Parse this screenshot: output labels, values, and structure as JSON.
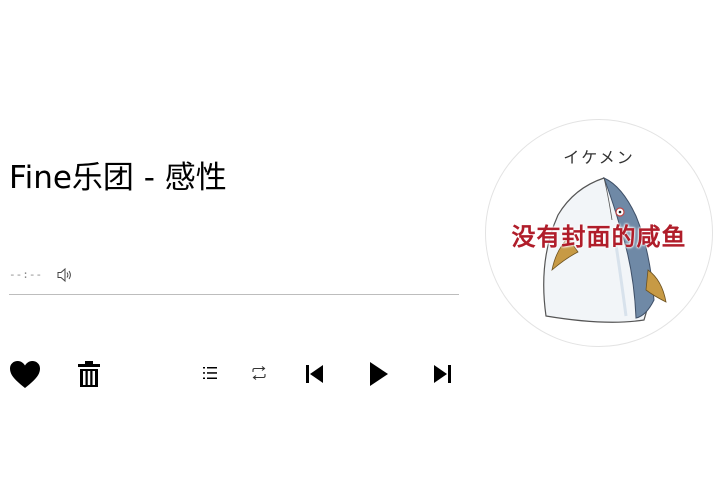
{
  "track": {
    "title": "Fine乐团 - 感性",
    "time": "--:--",
    "progress": 0
  },
  "controls": {
    "like_icon": "heart-icon",
    "delete_icon": "trash-icon",
    "playlist_icon": "list-icon",
    "repeat_icon": "repeat-icon",
    "prev_icon": "skip-previous-icon",
    "play_icon": "play-icon",
    "next_icon": "skip-next-icon",
    "volume_icon": "volume-icon"
  },
  "cover": {
    "caption": "没有封面的咸鱼",
    "doodle_text": "イケメン",
    "caption_color": "#b01d2a"
  }
}
